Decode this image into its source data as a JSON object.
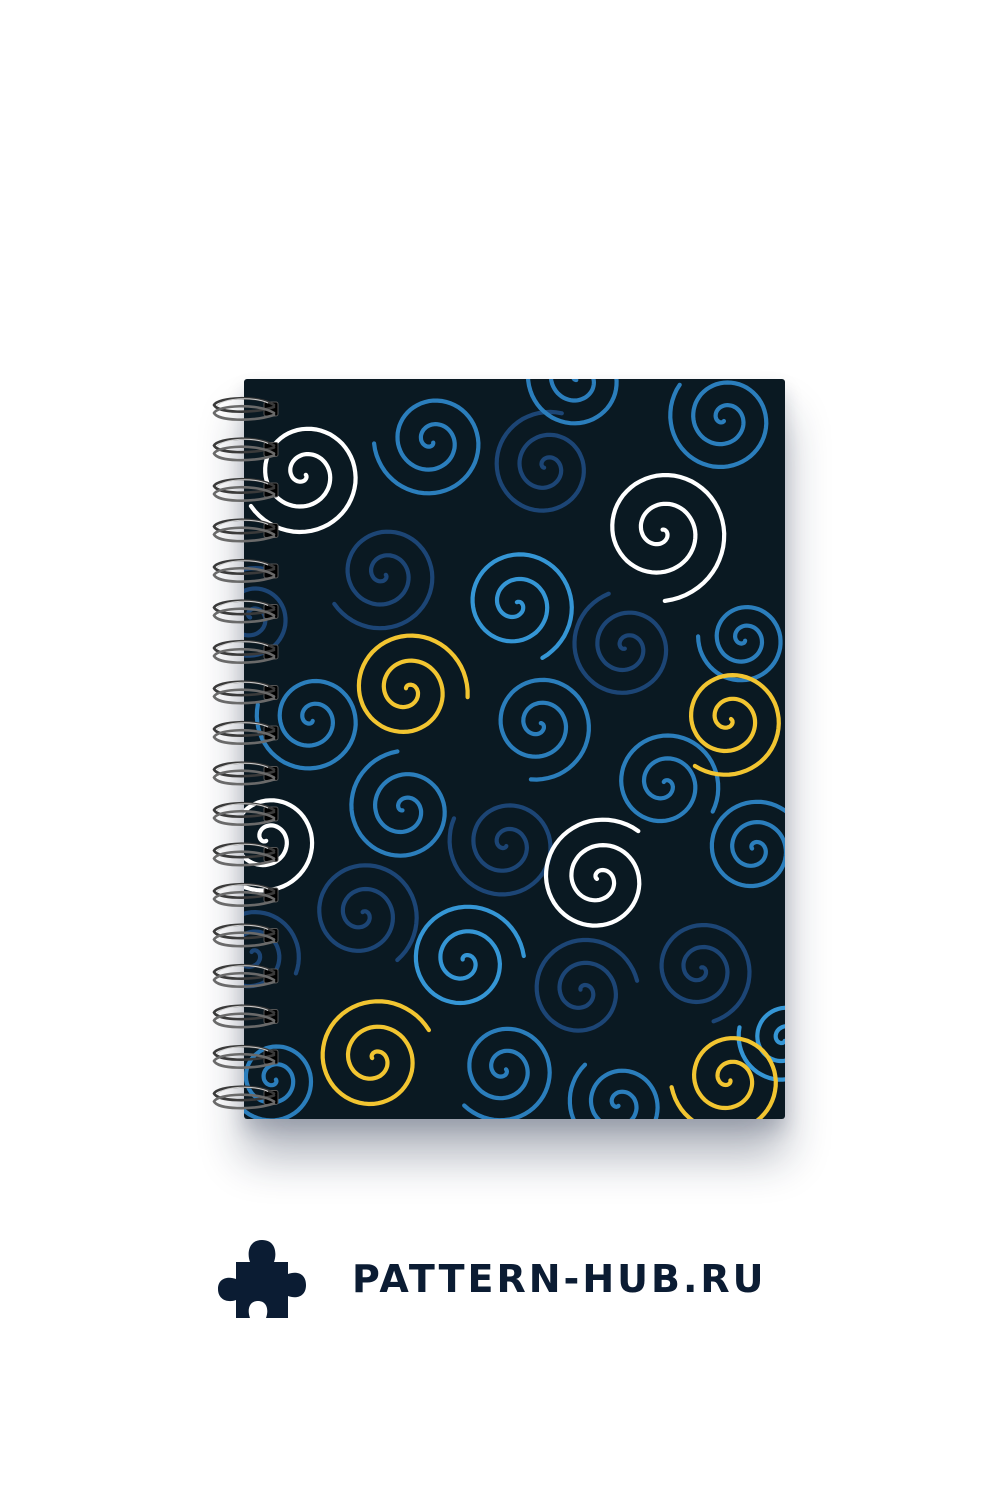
{
  "brand": {
    "site": "PATTERN-HUB.RU",
    "logo_icon": "puzzle-piece-icon",
    "text_color": "#0b1c33"
  },
  "notebook": {
    "cover_color": "#0a1922",
    "binding": "spiral-wire",
    "palette": {
      "white": "#ffffff",
      "yellow": "#f2c531",
      "light_blue": "#3596d5",
      "blue": "#2b7ebc",
      "dark_blue": "#1c4575"
    }
  }
}
